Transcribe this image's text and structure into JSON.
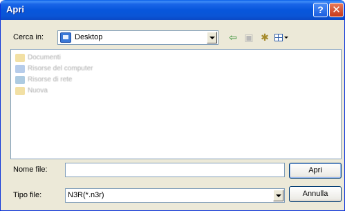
{
  "window": {
    "title": "Apri"
  },
  "titlebar_buttons": {
    "help": "?",
    "close": "✕"
  },
  "toolbar": {
    "look_in_label": "Cerca in:",
    "look_in_value": "Desktop",
    "back_icon": "⇦",
    "up_icon": "▣",
    "new_folder_icon": "✱",
    "view_menu_icon": "view-menu"
  },
  "file_list": {
    "items": [
      {
        "label": "Documenti",
        "icon": "folder-icon"
      },
      {
        "label": "Risorse del computer",
        "icon": "computer-icon"
      },
      {
        "label": "Risorse di rete",
        "icon": "network-icon"
      },
      {
        "label": "Nuova",
        "icon": "folder-icon"
      }
    ]
  },
  "form": {
    "filename_label": "Nome file:",
    "filename_value": "",
    "filetype_label": "Tipo file:",
    "filetype_value": "N3R(*.n3r)"
  },
  "buttons": {
    "open": "Apri",
    "cancel": "Annulla"
  }
}
